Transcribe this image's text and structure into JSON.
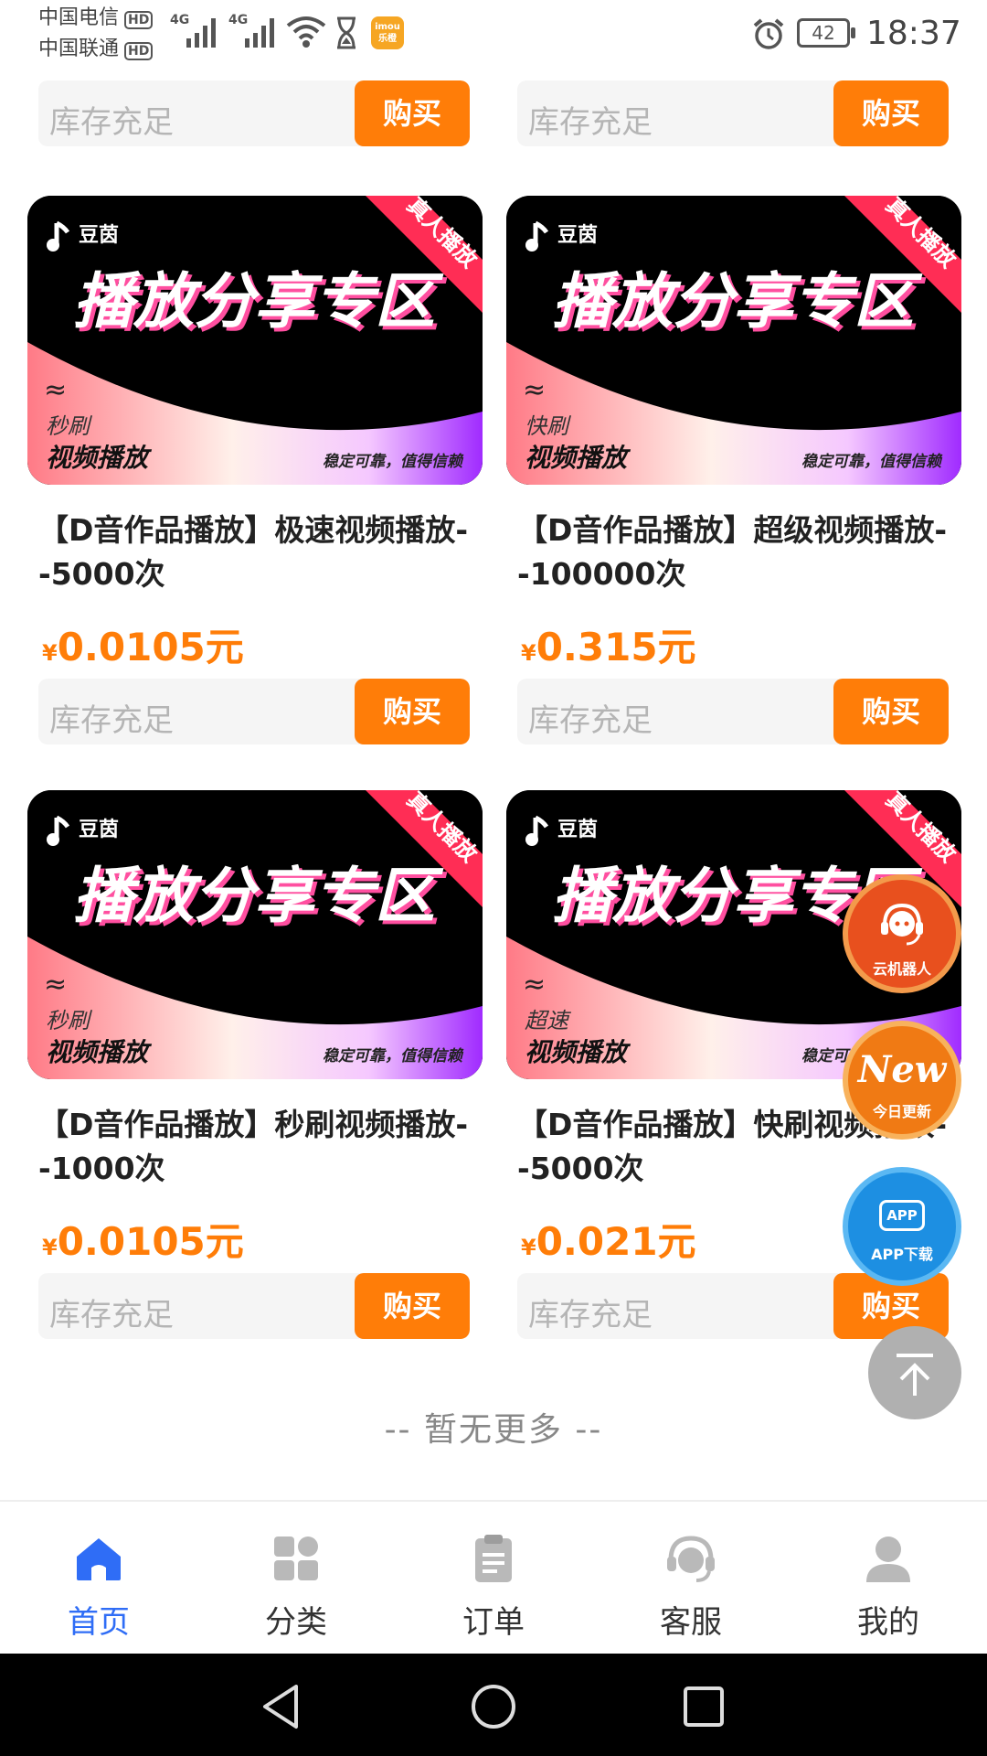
{
  "status_bar": {
    "carrier1": "中国电信",
    "carrier2": "中国联通",
    "hd_label": "HD",
    "network_type": "4G",
    "app_badge": "imou 乐橙",
    "battery": "42",
    "time": "18:37"
  },
  "top_buy_rows": [
    {
      "stock": "库存充足",
      "buy": "购买"
    },
    {
      "stock": "库存充足",
      "buy": "购买"
    }
  ],
  "banner": {
    "brand": "豆茵",
    "corner": "真人播放",
    "headline": "播放分享专区",
    "wave": "≈",
    "tagline_main": "视频播放",
    "slogan": "稳定可靠，值得信赖"
  },
  "products": [
    {
      "sub": "秒刷",
      "title": "【D音作品播放】极速视频播放--5000次",
      "yen": "¥",
      "price": "0.0105元",
      "stock": "库存充足",
      "buy": "购买"
    },
    {
      "sub": "快刷",
      "title": "【D音作品播放】超级视频播放--100000次",
      "yen": "¥",
      "price": "0.315元",
      "stock": "库存充足",
      "buy": "购买"
    },
    {
      "sub": "秒刷",
      "title": "【D音作品播放】秒刷视频播放--1000次",
      "yen": "¥",
      "price": "0.0105元",
      "stock": "库存充足",
      "buy": "购买"
    },
    {
      "sub": "超速",
      "title": "【D音作品播放】快刷视频播放--5000次",
      "yen": "¥",
      "price": "0.021元",
      "stock": "库存充足",
      "buy": "购买"
    }
  ],
  "no_more": "-- 暂无更多 --",
  "floating": {
    "robot": "云机器人",
    "new_main": "New",
    "new_sub": "今日更新",
    "app_icon": "APP",
    "app_label": "APP下载"
  },
  "tabs": [
    {
      "label": "首页",
      "icon": "home-icon",
      "active": true
    },
    {
      "label": "分类",
      "icon": "grid-icon",
      "active": false
    },
    {
      "label": "订单",
      "icon": "clipboard-icon",
      "active": false
    },
    {
      "label": "客服",
      "icon": "headset-icon",
      "active": false
    },
    {
      "label": "我的",
      "icon": "user-icon",
      "active": false
    }
  ],
  "colors": {
    "accent_orange": "#ff7d08",
    "tab_active": "#2f6df6",
    "tab_inactive": "#b9b9b9"
  }
}
